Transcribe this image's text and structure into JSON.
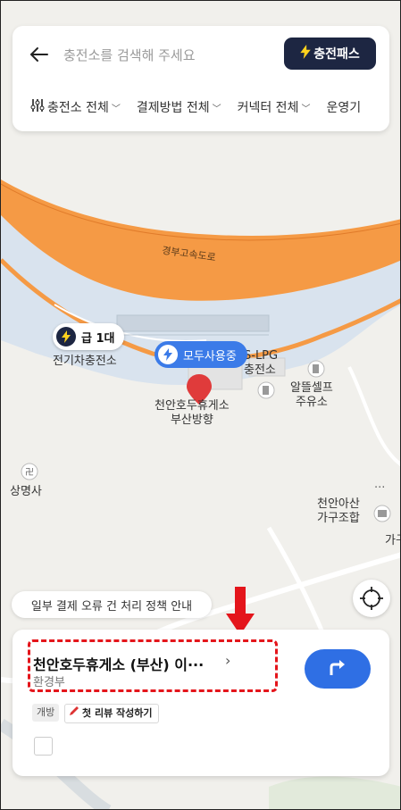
{
  "search": {
    "placeholder": "충전소를 검색해 주세요"
  },
  "header": {
    "pass_label": "충전패스"
  },
  "filters": [
    {
      "label": "충전소 전체"
    },
    {
      "label": "결제방법 전체"
    },
    {
      "label": "커넥터 전체"
    },
    {
      "label": "운영기"
    }
  ],
  "map": {
    "road_label": "경부고속도로",
    "fast_badge": "급 1대",
    "status_badge": "모두사용중",
    "labels": {
      "ev_station": "전기차충전소",
      "lpg_prefix": "S-LPG",
      "lpg_suffix": "충전소",
      "gas_station_line1": "알뜰셀프",
      "gas_station_line2": "주유소",
      "rest_area_line1": "천안호두휴게소",
      "rest_area_line2": "부산방향",
      "temple": "상명사",
      "furniture_line1": "천안아산",
      "furniture_line2": "가구조합",
      "partial_right": "가구",
      "dots": "···"
    }
  },
  "notice": {
    "text": "일부 결제 오류 건 처리 정책 안내"
  },
  "station": {
    "name": "천안호두휴게소 (부산) 이···",
    "operator": "환경부",
    "tag_open": "개방",
    "tag_review": "첫 리뷰 작성하기"
  },
  "colors": {
    "accent_blue": "#2f6fe4",
    "navy": "#1d2642",
    "highway_orange": "#f59a45",
    "highlight_red": "#e4151b",
    "pass_yellow": "#ffd21e"
  },
  "icons": [
    "back-arrow-icon",
    "lightning-icon",
    "filter-sliders-icon",
    "chevron-down-icon",
    "pin-icon",
    "gps-target-icon",
    "route-arrow-icon",
    "pencil-icon",
    "gas-icon",
    "temple-icon",
    "shop-icon"
  ]
}
